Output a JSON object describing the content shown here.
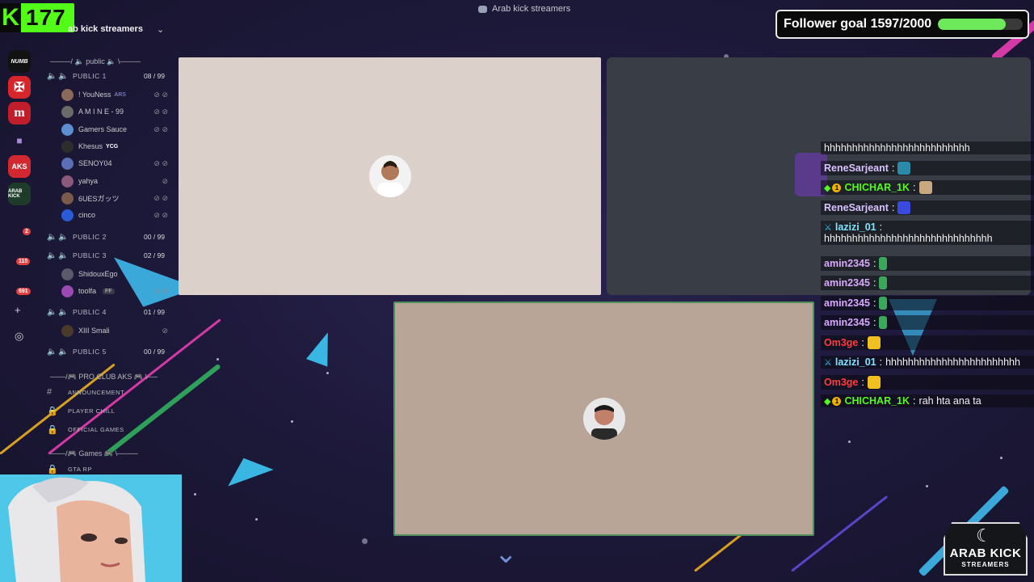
{
  "overlay": {
    "kick_count": "177",
    "kick_logo": "K",
    "window_title": "Arab kick streamers",
    "follower_goal": "Follower goal 1597/2000",
    "follower_progress": 0.7985
  },
  "rail": {
    "servers": [
      {
        "label": "NUMB",
        "color": "#121212"
      },
      {
        "label": "",
        "color": "#d7262b"
      },
      {
        "label": "",
        "color": "#c21d2a"
      },
      {
        "label": "",
        "color": "#2b2d31"
      },
      {
        "label": "AKS",
        "color": "#d2282f"
      },
      {
        "label": "",
        "color": "#1f3b2a"
      }
    ],
    "badges": [
      "2",
      "115",
      "691"
    ]
  },
  "sidebar": {
    "server_name": "ab kick streamers",
    "categories": {
      "public": "public",
      "pro_club": "PRO CLUB AKS",
      "games": "Games"
    },
    "voice_channels": [
      {
        "name": "PUBLIC 1",
        "count": "08 / 99"
      },
      {
        "name": "PUBLIC 2",
        "count": "00 / 99"
      },
      {
        "name": "PUBLIC 3",
        "count": "02 / 99"
      },
      {
        "name": "PUBLIC 4",
        "count": "01 / 99"
      },
      {
        "name": "PUBLIC 5",
        "count": "00 / 99"
      }
    ],
    "public1_users": [
      {
        "name": "! YouNess",
        "tag": "ARS",
        "color": "#8a6b5a"
      },
      {
        "name": "A M I N E - 99",
        "tag": "",
        "color": "#6a6a6a"
      },
      {
        "name": "Gamers Sauce",
        "tag": "",
        "color": "#5b8fd1"
      },
      {
        "name": "Khesus",
        "tag": "YCG",
        "color": "#2d2d2d"
      },
      {
        "name": "SENOY04",
        "tag": "",
        "color": "#5a6fb5"
      },
      {
        "name": "yahya",
        "tag": "",
        "color": "#8a5a7a"
      },
      {
        "name": "6UESガッツ",
        "tag": "",
        "color": "#7a5a4a"
      },
      {
        "name": "cinco",
        "tag": "",
        "color": "#2a5bd7"
      }
    ],
    "public3_users": [
      {
        "name": "ShidouxEgo",
        "tag": "",
        "color": "#5a5a6a"
      },
      {
        "name": "toolfa",
        "tag": "FF",
        "color": "#9a4ab0"
      }
    ],
    "public4_users": [
      {
        "name": "XIII Smali",
        "tag": "",
        "color": "#4a3a2a"
      }
    ],
    "text_channels": [
      {
        "name": "ANNOUNCEMENT"
      },
      {
        "name": "PLAYER CHILL"
      },
      {
        "name": "OFFICIAL GAMES"
      },
      {
        "name": "GTA RP"
      }
    ]
  },
  "chat": [
    {
      "user": "",
      "text": "hhhhhhhhhhhhhhhhhhhhhhhhhh",
      "user_color": "#ffffff"
    },
    {
      "user": "ReneSarjeant",
      "text": "",
      "user_color": "#d9c2ff"
    },
    {
      "user": "CHICHAR_1K",
      "text": "",
      "user_color": "#53fc18"
    },
    {
      "user": "ReneSarjeant",
      "text": "",
      "user_color": "#d9c2ff"
    },
    {
      "user": "lazizi_01",
      "text": "hhhhhhhhhhhhhhhhhhhhhhhhhhhhhh",
      "user_color": "#7fe3ff"
    },
    {
      "user": "amin2345",
      "text": "",
      "user_color": "#d9a8ff"
    },
    {
      "user": "amin2345",
      "text": "",
      "user_color": "#d9a8ff"
    },
    {
      "user": "amin2345",
      "text": "",
      "user_color": "#d9a8ff"
    },
    {
      "user": "amin2345",
      "text": "",
      "user_color": "#d9a8ff"
    },
    {
      "user": "Om3ge",
      "text": "",
      "user_color": "#ff3b3b"
    },
    {
      "user": "lazizi_01",
      "text": "hhhhhhhhhhhhhhhhhhhhhhhh",
      "user_color": "#7fe3ff"
    },
    {
      "user": "Om3ge",
      "text": "",
      "user_color": "#ff3b3b"
    },
    {
      "user": "CHICHAR_1K",
      "text": "rah hta ana ta",
      "user_color": "#53fc18"
    }
  ],
  "chat_separator": ":",
  "badge_one": "1",
  "logo": {
    "line1": "ARAB KICK",
    "line2": "STREAMERS"
  },
  "colors": {
    "kick_green": "#53fc18",
    "goal_fill": "#6ee95b",
    "speaking_border": "#4f8f5a"
  }
}
